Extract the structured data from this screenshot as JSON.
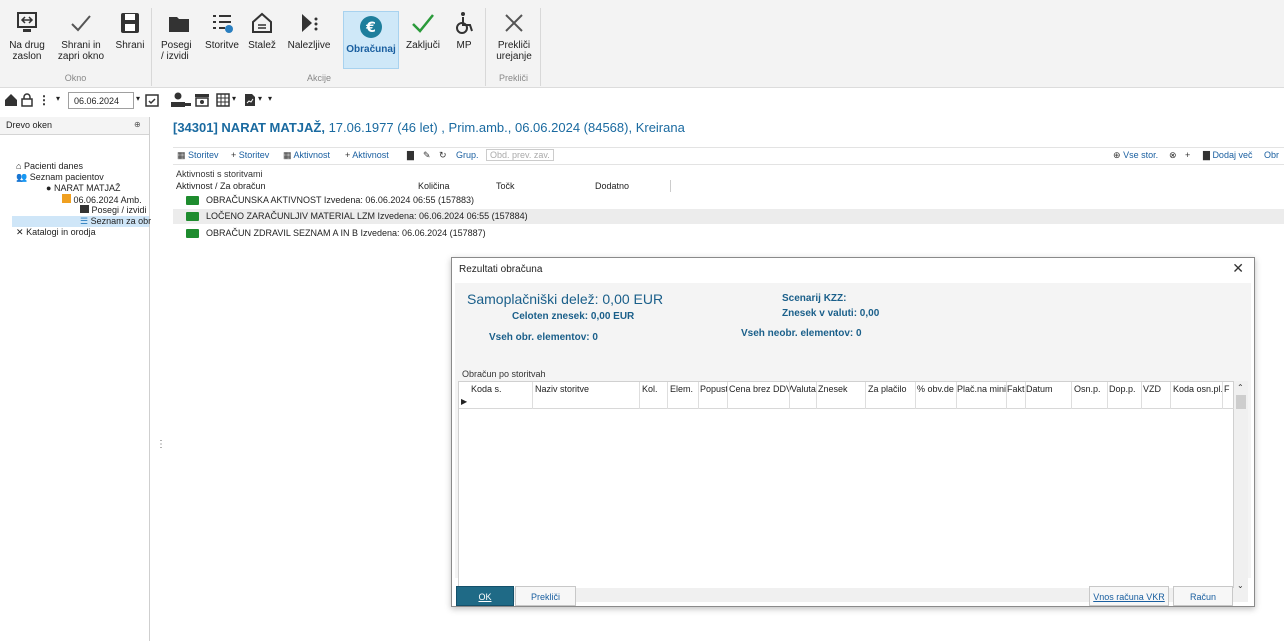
{
  "ribbon": {
    "groups": [
      {
        "caption": "Okno",
        "buttons": [
          {
            "label": "Na drug\nzaslon",
            "icon": "screen-switch-icon"
          },
          {
            "label": "Shrani in\nzapri okno",
            "icon": "check-icon"
          },
          {
            "label": "Shrani",
            "icon": "save-icon"
          }
        ]
      },
      {
        "caption": "Akcije",
        "buttons": [
          {
            "label": "Posegi\n/ izvidi",
            "icon": "folder-icon"
          },
          {
            "label": "Storitve",
            "icon": "list-icon"
          },
          {
            "label": "Stalež",
            "icon": "home-icon"
          },
          {
            "label": "Nalezljive",
            "icon": "virus-icon"
          },
          {
            "label": "Obračunaj",
            "icon": "euro-icon"
          },
          {
            "label": "Zaključi",
            "icon": "check-green-icon"
          },
          {
            "label": "MP",
            "icon": "wheelchair-icon"
          }
        ]
      },
      {
        "caption": "Prekliči",
        "buttons": [
          {
            "label": "Prekliči\nurejanje",
            "icon": "close-icon"
          }
        ]
      }
    ]
  },
  "quick": {
    "date": "06.06.2024"
  },
  "tree": {
    "header": "Drevo oken",
    "pin": "⊕",
    "items": [
      {
        "label": "Pacienti danes"
      },
      {
        "label": "Seznam pacientov"
      },
      {
        "label": "NARAT MATJAŽ"
      },
      {
        "label": "06.06.2024 Amb."
      },
      {
        "label": "Posegi / izvidi"
      },
      {
        "label": "Seznam za obr"
      },
      {
        "label": "Katalogi in orodja"
      }
    ]
  },
  "patient": {
    "id_name": "[34301] NARAT MATJAŽ,",
    "details": "17.06.1977 (46 let) , Prim.amb., 06.06.2024 (84568), Kreirana"
  },
  "toolbar2": {
    "storitev1": "Storitev",
    "storitev2": "Storitev",
    "aktivnost1": "Aktivnost",
    "aktivnost2": "Aktivnost",
    "grup": "Grup.",
    "obd": "Obd. prev. zav.",
    "vse": "Vse stor.",
    "dodaj": "Dodaj več",
    "obr": "Obr"
  },
  "activities": {
    "section_title": "Aktivnosti s storitvami",
    "columns": [
      "Aktivnost / Za obračun",
      "Količina",
      "Točk",
      "Dodatno"
    ],
    "rows": [
      "OBRAČUNSKA AKTIVNOST Izvedena: 06.06.2024 06:55 (157883)",
      "LOČENO ZARAČUNLJIV MATERIAL LZM Izvedena: 06.06.2024 06:55 (157884)",
      "OBRAČUN ZDRAVIL SEZNAM A IN B Izvedena: 06.06.2024 (157887)"
    ]
  },
  "dialog": {
    "title": "Rezultati obračuna",
    "samoplacniski": "Samoplačniški delež: 0,00 EUR",
    "celoten": "Celoten znesek: 0,00 EUR",
    "vseh_obr": "Vseh obr. elementov: 0",
    "scenarij": "Scenarij KZZ:",
    "znesek_valuti": "Znesek v valuti: 0,00",
    "vseh_neobr": "Vseh neobr. elementov: 0",
    "section": "Obračun po storitvah",
    "columns": [
      "Koda s.",
      "Naziv storitve",
      "Kol.",
      "Elem.",
      "Popust",
      "Cena brez DDV",
      "Valuta",
      "Znesek",
      "Za plačilo",
      "% obv.de",
      "Plač.na mini",
      "Fakt",
      "Datum",
      "Osn.p.",
      "Dop.p.",
      "VZD",
      "Koda osn.pl.",
      "F"
    ],
    "buttons": {
      "ok": "OK",
      "cancel": "Prekliči",
      "vkr": "Vnos računa VKR",
      "racun": "Račun"
    }
  }
}
